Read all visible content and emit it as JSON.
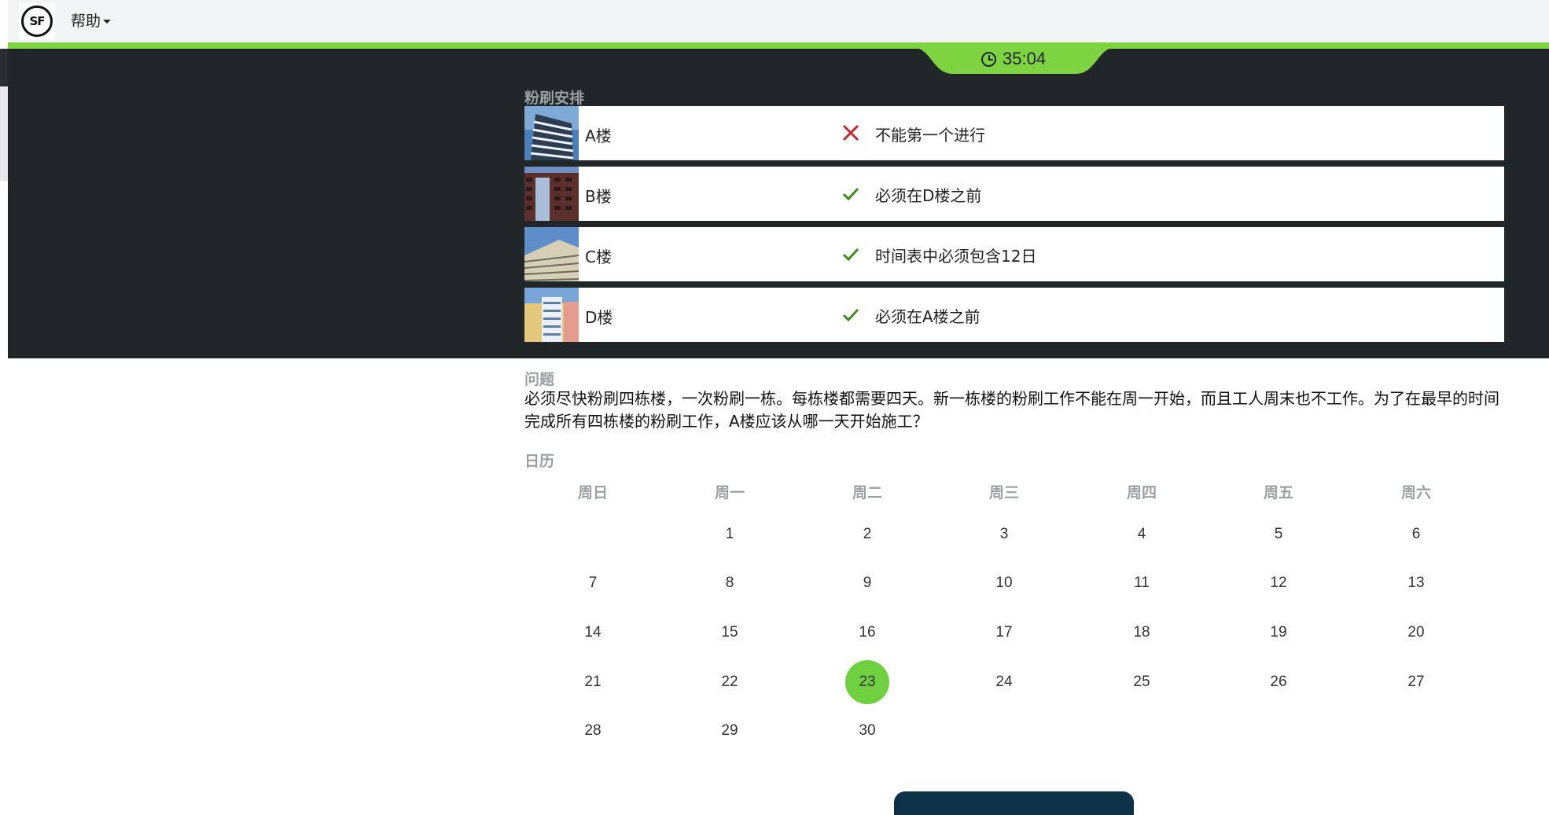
{
  "header": {
    "logo_text": "SF",
    "help_label": "帮助"
  },
  "timer": {
    "value": "35:04"
  },
  "schedule": {
    "title": "粉刷安排",
    "rows": [
      {
        "building": "A楼",
        "status": "cross",
        "condition": "不能第一个进行"
      },
      {
        "building": "B楼",
        "status": "check",
        "condition": "必须在D楼之前"
      },
      {
        "building": "C楼",
        "status": "check",
        "condition": "时间表中必须包含12日"
      },
      {
        "building": "D楼",
        "status": "check",
        "condition": "必须在A楼之前"
      }
    ]
  },
  "question": {
    "title": "问题",
    "text": "必须尽快粉刷四栋楼，一次粉刷一栋。每栋楼都需要四天。新一栋楼的粉刷工作不能在周一开始，而且工人周末也不工作。为了在最早的时间完成所有四栋楼的粉刷工作，A楼应该从哪一天开始施工？"
  },
  "calendar": {
    "title": "日历",
    "weekdays": [
      "周日",
      "周一",
      "周二",
      "周三",
      "周四",
      "周五",
      "周六"
    ],
    "weeks": [
      [
        "",
        "1",
        "2",
        "3",
        "4",
        "5",
        "6"
      ],
      [
        "7",
        "8",
        "9",
        "10",
        "11",
        "12",
        "13"
      ],
      [
        "14",
        "15",
        "16",
        "17",
        "18",
        "19",
        "20"
      ],
      [
        "21",
        "22",
        "23",
        "24",
        "25",
        "26",
        "27"
      ],
      [
        "28",
        "29",
        "30",
        "",
        "",
        "",
        ""
      ]
    ],
    "selected_day": "23"
  },
  "colors": {
    "accent_green": "#7ed341",
    "selected_day": "#6fd13f",
    "cross": "#c0282d",
    "check": "#3f8c1c",
    "dark_panel": "#212629"
  }
}
